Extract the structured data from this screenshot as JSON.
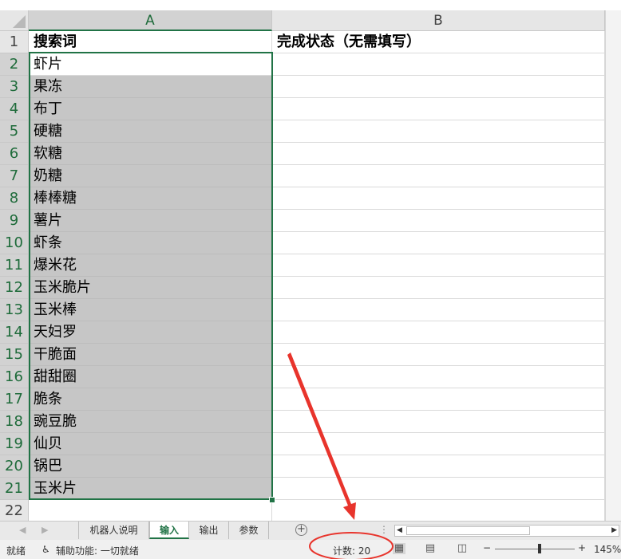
{
  "columns": [
    "A",
    "B"
  ],
  "header_row": {
    "row": "1",
    "a": "搜索词",
    "b": "完成状态（无需填写）"
  },
  "rows": [
    {
      "n": "2",
      "a": "虾片"
    },
    {
      "n": "3",
      "a": "果冻"
    },
    {
      "n": "4",
      "a": "布丁"
    },
    {
      "n": "5",
      "a": "硬糖"
    },
    {
      "n": "6",
      "a": "软糖"
    },
    {
      "n": "7",
      "a": "奶糖"
    },
    {
      "n": "8",
      "a": "棒棒糖"
    },
    {
      "n": "9",
      "a": "薯片"
    },
    {
      "n": "10",
      "a": "虾条"
    },
    {
      "n": "11",
      "a": "爆米花"
    },
    {
      "n": "12",
      "a": "玉米脆片"
    },
    {
      "n": "13",
      "a": "玉米棒"
    },
    {
      "n": "14",
      "a": "天妇罗"
    },
    {
      "n": "15",
      "a": "干脆面"
    },
    {
      "n": "16",
      "a": "甜甜圈"
    },
    {
      "n": "17",
      "a": "脆条"
    },
    {
      "n": "18",
      "a": "豌豆脆"
    },
    {
      "n": "19",
      "a": "仙贝"
    },
    {
      "n": "20",
      "a": "锅巴"
    },
    {
      "n": "21",
      "a": "玉米片"
    },
    {
      "n": "22",
      "a": ""
    }
  ],
  "sheets": [
    {
      "label": "机器人说明",
      "active": false
    },
    {
      "label": "输入",
      "active": true
    },
    {
      "label": "输出",
      "active": false
    },
    {
      "label": "参数",
      "active": false
    }
  ],
  "status": {
    "ready": "就绪",
    "accessibility": "辅助功能: 一切就绪",
    "count": "计数: 20",
    "zoom_minus": "−",
    "zoom_plus": "+",
    "zoom": "145%"
  },
  "colors": {
    "accent": "#217346",
    "selection_fill": "#c6c6c6",
    "annotation": "#e8342c"
  }
}
